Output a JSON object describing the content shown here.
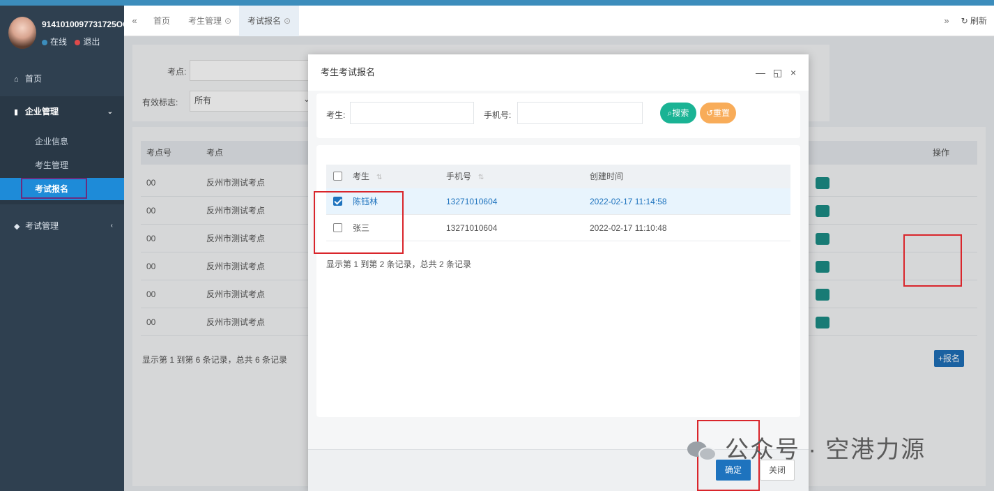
{
  "user": {
    "id": "9141010097731725OC",
    "status_online": "在线",
    "logout": "退出"
  },
  "sidebar": {
    "home": "首页",
    "group_enterprise": "企业管理",
    "sub_items": [
      "企业信息",
      "考生管理",
      "考试报名"
    ],
    "exam_management": "考试管理"
  },
  "tabs": {
    "home": "首页",
    "candidate_mgmt": "考生管理",
    "exam_signup": "考试报名",
    "refresh": "刷新"
  },
  "background_page": {
    "search": {
      "exam_site_label": "考点:",
      "valid_label": "有效标志:",
      "valid_value": "所有"
    },
    "table": {
      "headers": [
        "考点号",
        "考点",
        "操作"
      ],
      "rows": [
        {
          "code": "00",
          "site": "反州市测试考点"
        },
        {
          "code": "00",
          "site": "反州市测试考点"
        },
        {
          "code": "00",
          "site": "反州市测试考点"
        },
        {
          "code": "00",
          "site": "反州市测试考点"
        },
        {
          "code": "00",
          "site": "反州市测试考点"
        },
        {
          "code": "00",
          "site": "反州市测试考点"
        }
      ],
      "footer": "显示第 1 到第 6 条记录，总共 6 条记录"
    },
    "enroll_button": "+报名"
  },
  "modal": {
    "title": "考生考试报名",
    "search": {
      "candidate_label": "考生:",
      "phone_label": "手机号:",
      "search_button": "搜索",
      "reset_button": "重置"
    },
    "table": {
      "headers": [
        "考生",
        "手机号",
        "创建时间"
      ],
      "rows": [
        {
          "checked": true,
          "name": "陈钰林",
          "phone": "13271010604",
          "created": "2022-02-17 11:14:58"
        },
        {
          "checked": false,
          "name": "张三",
          "phone": "13271010604",
          "created": "2022-02-17 11:10:48"
        }
      ],
      "pager": "显示第 1 到第 2 条记录，总共 2 条记录"
    },
    "ok_button": "确定",
    "close_button": "关闭"
  },
  "watermark": "公众号 · 空港力源",
  "colors": {
    "sidebar_bg": "#2f4050",
    "active_menu": "#1e8bd8",
    "primary": "#1e73be",
    "search_green": "#1ab394",
    "reset_orange": "#f8ac59",
    "annotation_red": "#d9252b"
  }
}
